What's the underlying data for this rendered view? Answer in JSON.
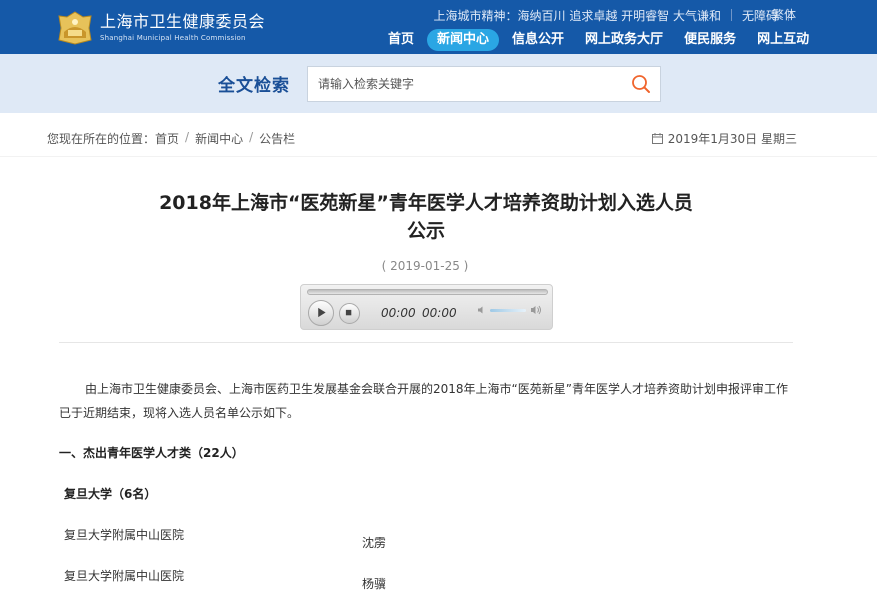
{
  "header": {
    "logo_cn": "上海市卫生健康委员会",
    "logo_en": "Shanghai Municipal Health Commission",
    "motto": "上海城市精神：海纳百川 追求卓越 开明睿智 大气谦和",
    "accessibility": "无障碍",
    "language": "繁体",
    "nav": [
      {
        "label": "首页",
        "active": false
      },
      {
        "label": "新闻中心",
        "active": true
      },
      {
        "label": "信息公开",
        "active": false
      },
      {
        "label": "网上政务大厅",
        "active": false
      },
      {
        "label": "便民服务",
        "active": false
      },
      {
        "label": "网上互动",
        "active": false
      }
    ]
  },
  "search": {
    "label": "全文检索",
    "placeholder": "请输入检索关键字",
    "icon": "search-icon"
  },
  "breadcrumb": {
    "prefix": "您现在所在的位置：",
    "items": [
      "首页",
      "新闻中心",
      "公告栏"
    ],
    "separator": "/"
  },
  "date_display": "2019年1月30日 星期三",
  "article": {
    "title_line1": "2018年上海市“医苑新星”青年医学人才培养资助计划入选人员",
    "title_line2": "公示",
    "published": "( 2019-01-25 )",
    "player": {
      "current_time": "00:00",
      "duration": "00:00"
    },
    "intro": "由上海市卫生健康委员会、上海市医药卫生发展基金会联合开展的2018年上海市“医苑新星”青年医学人才培养资助计划申报评审工作已于近期结束，现将入选人员名单公示如下。",
    "section_heading": "一、杰出青年医学人才类（22人）",
    "org_heading": "复旦大学（6名）",
    "rows": [
      {
        "hospital": "复旦大学附属中山医院",
        "name": "沈雳"
      },
      {
        "hospital": "复旦大学附属中山医院",
        "name": "杨骥"
      }
    ]
  },
  "colors": {
    "header_bg": "#1559a8",
    "nav_active": "#2aa6e4",
    "search_band": "#dfe9f6",
    "search_label": "#1a4f97",
    "search_icon": "#f0642c"
  }
}
